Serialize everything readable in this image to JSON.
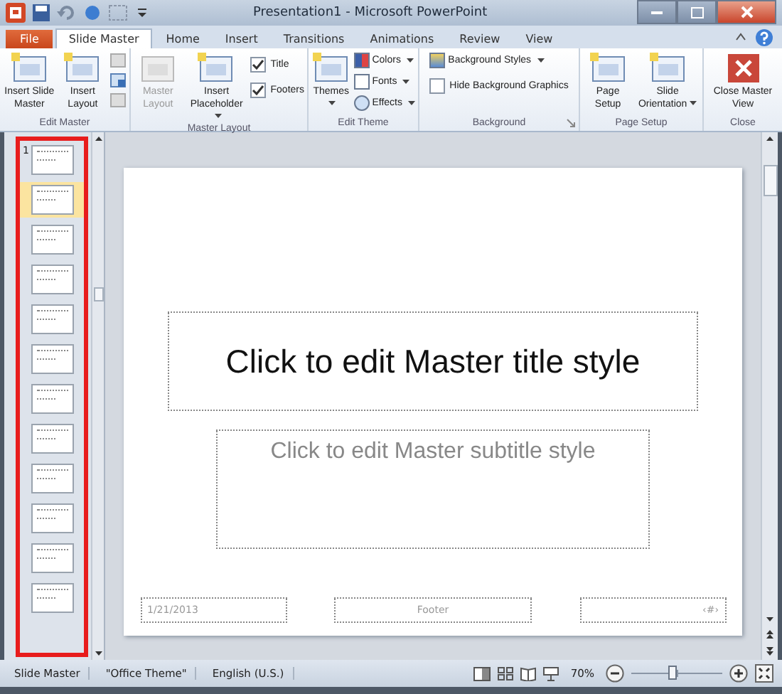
{
  "window": {
    "title": "Presentation1 - Microsoft PowerPoint"
  },
  "tabs": [
    {
      "label": "File",
      "kind": "file",
      "selected": false
    },
    {
      "label": "Slide Master",
      "kind": "tab",
      "selected": true
    },
    {
      "label": "Home",
      "kind": "tab",
      "selected": false
    },
    {
      "label": "Insert",
      "kind": "tab",
      "selected": false
    },
    {
      "label": "Transitions",
      "kind": "tab",
      "selected": false
    },
    {
      "label": "Animations",
      "kind": "tab",
      "selected": false
    },
    {
      "label": "Review",
      "kind": "tab",
      "selected": false
    },
    {
      "label": "View",
      "kind": "tab",
      "selected": false
    }
  ],
  "ribbon": [
    {
      "label": "Edit Master",
      "items": [
        {
          "kind": "large",
          "label": "Insert Slide Master",
          "disabled": false,
          "dropdown": false
        },
        {
          "kind": "large",
          "label": "Insert Layout",
          "disabled": false,
          "dropdown": false
        },
        {
          "kind": "icons"
        }
      ]
    },
    {
      "label": "Master Layout",
      "items": [
        {
          "kind": "large",
          "label": "Master Layout",
          "disabled": true,
          "dropdown": false
        },
        {
          "kind": "large",
          "label": "Insert Placeholder",
          "disabled": false,
          "dropdown": true
        },
        {
          "kind": "checks",
          "checks": [
            {
              "label": "Title",
              "checked": true
            },
            {
              "label": "Footers",
              "checked": true
            }
          ]
        }
      ]
    },
    {
      "label": "Edit Theme",
      "items": [
        {
          "kind": "large",
          "label": "Themes",
          "disabled": false,
          "dropdown": true
        },
        {
          "kind": "menus",
          "menus": [
            "Colors",
            "Fonts",
            "Effects"
          ]
        }
      ]
    },
    {
      "label": "Background",
      "launcher": true,
      "items": [
        {
          "kind": "bg",
          "menu": "Background Styles",
          "checks": [
            {
              "label": "Hide Background Graphics",
              "checked": false
            }
          ]
        }
      ]
    },
    {
      "label": "Page Setup",
      "items": [
        {
          "kind": "large",
          "label": "Page Setup",
          "disabled": false,
          "dropdown": false
        },
        {
          "kind": "large",
          "label": "Slide Orientation",
          "disabled": false,
          "dropdown": true
        }
      ]
    },
    {
      "label": "Close",
      "items": [
        {
          "kind": "close",
          "label": "Close Master View",
          "disabled": false,
          "dropdown": false
        }
      ]
    }
  ],
  "thumbnails": [
    {
      "number": "1",
      "selected": false
    },
    {
      "selected": true
    },
    {
      "selected": false
    },
    {
      "selected": false
    },
    {
      "selected": false
    },
    {
      "selected": false
    },
    {
      "selected": false
    },
    {
      "selected": false
    },
    {
      "selected": false
    },
    {
      "selected": false
    },
    {
      "selected": false
    },
    {
      "selected": false
    }
  ],
  "slide": {
    "title": "Click to edit Master title style",
    "subtitle": "Click to edit Master subtitle style",
    "date": "1/21/2013",
    "footer": "Footer",
    "number": "‹#›"
  },
  "status_bar": {
    "items": [
      "Slide Master",
      "\"Office Theme\"",
      "English (U.S.)"
    ],
    "zoom": "70%",
    "zoom_slider": {
      "level": 0.45
    }
  }
}
